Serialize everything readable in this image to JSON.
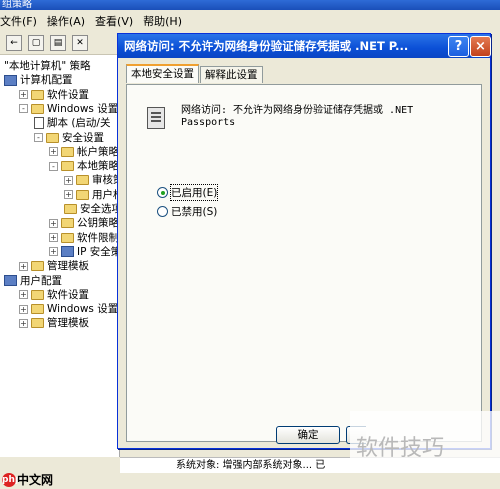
{
  "background": {
    "title_fragment": "组策略",
    "menu": [
      "文件(F)",
      "操作(A)",
      "查看(V)",
      "帮助(H)"
    ],
    "tree": [
      {
        "label": "\"本地计算机\" 策略",
        "indent": 0,
        "icon": "none",
        "exp": ""
      },
      {
        "label": "计算机配置",
        "indent": 0,
        "icon": "pc",
        "exp": ""
      },
      {
        "label": "软件设置",
        "indent": 1,
        "icon": "folder",
        "exp": "+"
      },
      {
        "label": "Windows 设置",
        "indent": 1,
        "icon": "folder",
        "exp": "-"
      },
      {
        "label": "脚本 (启动/关",
        "indent": 2,
        "icon": "doc",
        "exp": ""
      },
      {
        "label": "安全设置",
        "indent": 2,
        "icon": "folder",
        "exp": "-"
      },
      {
        "label": "帐户策略",
        "indent": 3,
        "icon": "folder",
        "exp": "+"
      },
      {
        "label": "本地策略",
        "indent": 3,
        "icon": "folder",
        "exp": "-"
      },
      {
        "label": "审核策略",
        "indent": 4,
        "icon": "folder",
        "exp": "+"
      },
      {
        "label": "用户权限",
        "indent": 4,
        "icon": "folder",
        "exp": "+"
      },
      {
        "label": "安全选项",
        "indent": 4,
        "icon": "folder",
        "exp": ""
      },
      {
        "label": "公钥策略",
        "indent": 3,
        "icon": "folder",
        "exp": "+"
      },
      {
        "label": "软件限制策略",
        "indent": 3,
        "icon": "folder",
        "exp": "+"
      },
      {
        "label": "IP 安全策略",
        "indent": 3,
        "icon": "pc",
        "exp": "+"
      },
      {
        "label": "管理模板",
        "indent": 1,
        "icon": "folder",
        "exp": "+"
      },
      {
        "label": "用户配置",
        "indent": 0,
        "icon": "pc",
        "exp": ""
      },
      {
        "label": "软件设置",
        "indent": 1,
        "icon": "folder",
        "exp": "+"
      },
      {
        "label": "Windows 设置",
        "indent": 1,
        "icon": "folder",
        "exp": "+"
      },
      {
        "label": "管理模板",
        "indent": 1,
        "icon": "folder",
        "exp": "+"
      }
    ],
    "bottom_row": "系统对象: 增强内部系统对象...   已"
  },
  "dialog": {
    "title": "网络访问: 不允许为网络身份验证储存凭据或 .NET P...",
    "help_label": "?",
    "close_label": "×",
    "tabs": [
      {
        "label": "本地安全设置",
        "active": true
      },
      {
        "label": "解释此设置",
        "active": false
      }
    ],
    "policy_text": "网络访问: 不允许为网络身份验证储存凭据或 .NET Passports",
    "options": [
      {
        "label": "已启用(E)",
        "selected": true
      },
      {
        "label": "已禁用(S)",
        "selected": false
      }
    ],
    "ok_label": "确定"
  },
  "watermark": {
    "text": "软件技巧",
    "logo_text": "中文网",
    "logo_badge": "php"
  },
  "colors": {
    "title_blue": "#0b4fd6",
    "dialog_bg": "#ECE9D8",
    "radio_green": "#21a121"
  }
}
